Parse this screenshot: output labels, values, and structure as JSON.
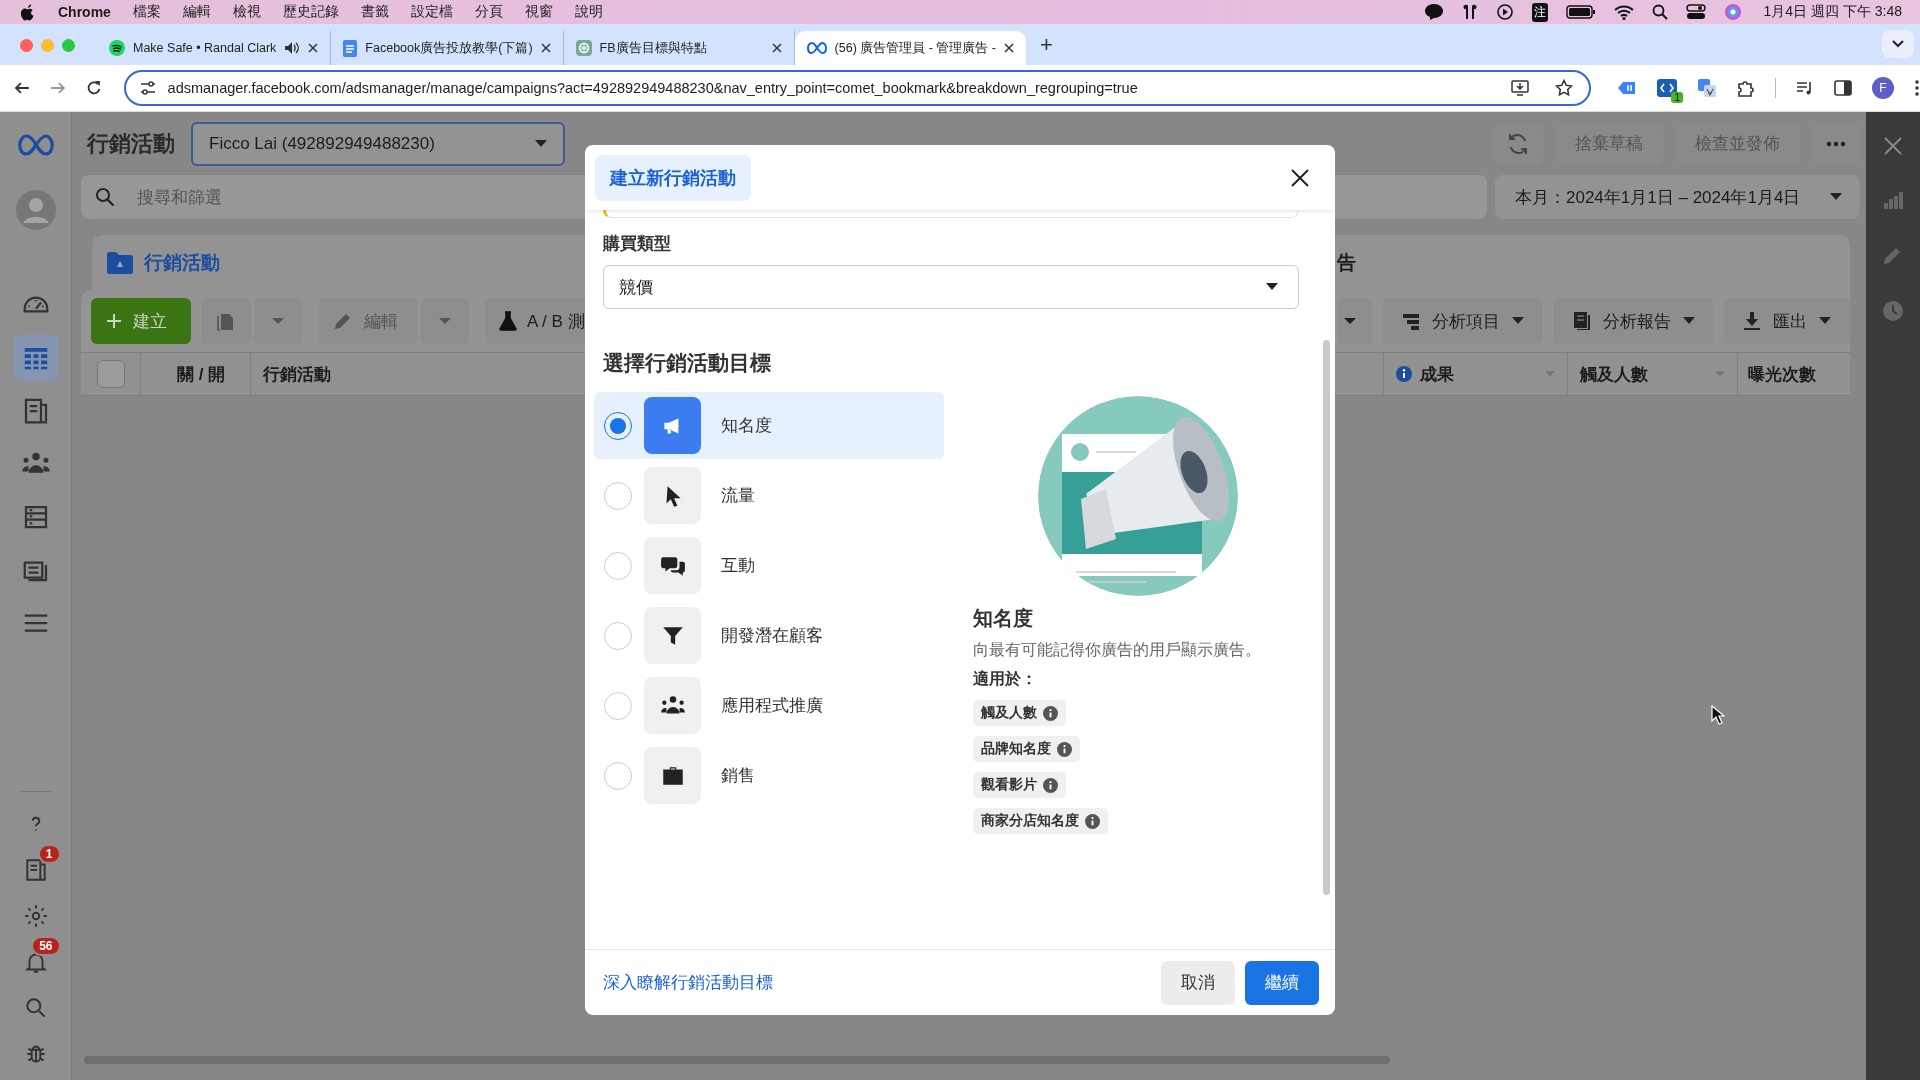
{
  "menu_bar": {
    "app": "Chrome",
    "menus": [
      "檔案",
      "編輯",
      "檢視",
      "歷史記錄",
      "書籤",
      "設定檔",
      "分頁",
      "視窗",
      "說明"
    ],
    "input_method": "注",
    "clock": "1月4日 週四 下午 3:48"
  },
  "browser": {
    "tabs": [
      {
        "title": "Make Safe • Randal Clark",
        "audio": true,
        "selected": false
      },
      {
        "title": "Facebook廣告投放教學(下篇)",
        "audio": false,
        "selected": false
      },
      {
        "title": "FB廣告目標與特點",
        "audio": false,
        "selected": false
      },
      {
        "title": "(56) 廣告管理員 - 管理廣告 -",
        "audio": false,
        "selected": true
      }
    ],
    "new_tab": "+",
    "url": "adsmanager.facebook.com/adsmanager/manage/campaigns?act=492892949488230&nav_entry_point=comet_bookmark&breakdown_regrouping=true",
    "extension_badge": "1",
    "profile_initial": "F"
  },
  "nav": {
    "items": [
      {
        "selected": false
      },
      {
        "selected": true
      },
      {
        "selected": false
      },
      {
        "selected": false
      },
      {
        "selected": false
      },
      {
        "selected": false
      },
      {
        "selected": false
      }
    ],
    "bottom": [
      {
        "selected": false
      },
      {
        "selected": false,
        "badge": "1"
      },
      {
        "selected": false
      },
      {
        "selected": false,
        "badge": "56"
      },
      {
        "selected": false
      },
      {
        "selected": false
      }
    ]
  },
  "header": {
    "title": "行銷活動",
    "account": "Ficco Lai (492892949488230)",
    "discard": "捨棄草稿",
    "publish": "檢查並發佈"
  },
  "search": {
    "placeholder": "搜尋和篩選"
  },
  "date_range": "本月：2024年1月1日 – 2024年1月4日",
  "level_tabs": [
    {
      "label": "行銷活動",
      "selected": true
    },
    {
      "label": "告",
      "selected": false
    }
  ],
  "toolbar": {
    "create": "建立",
    "edit": "編輯",
    "ab_test": "A / B 測",
    "breakdown": "分析項目",
    "reports": "分析報告",
    "export": "匯出"
  },
  "table": {
    "select_all": {
      "checked": false
    },
    "columns": [
      "關 / 開",
      "行銷活動",
      "成果",
      "觸及人數",
      "曝光次數"
    ]
  },
  "dialog": {
    "tab": "建立新行銷活動",
    "buying_type_label": "購買類型",
    "buying_type": "競價",
    "heading": "選擇行銷活動目標",
    "objectives": [
      {
        "label": "知名度",
        "selected": true
      },
      {
        "label": "流量",
        "selected": false
      },
      {
        "label": "互動",
        "selected": false
      },
      {
        "label": "開發潛在顧客",
        "selected": false
      },
      {
        "label": "應用程式推廣",
        "selected": false
      },
      {
        "label": "銷售",
        "selected": false
      }
    ],
    "detail": {
      "title": "知名度",
      "description": "向最有可能記得你廣告的用戶顯示廣告。",
      "good_for_label": "適用於：",
      "good_for": [
        "觸及人數",
        "品牌知名度",
        "觀看影片",
        "商家分店知名度"
      ]
    },
    "learn_more": "深入瞭解行銷活動目標",
    "cancel": "取消",
    "continue": "繼續"
  }
}
